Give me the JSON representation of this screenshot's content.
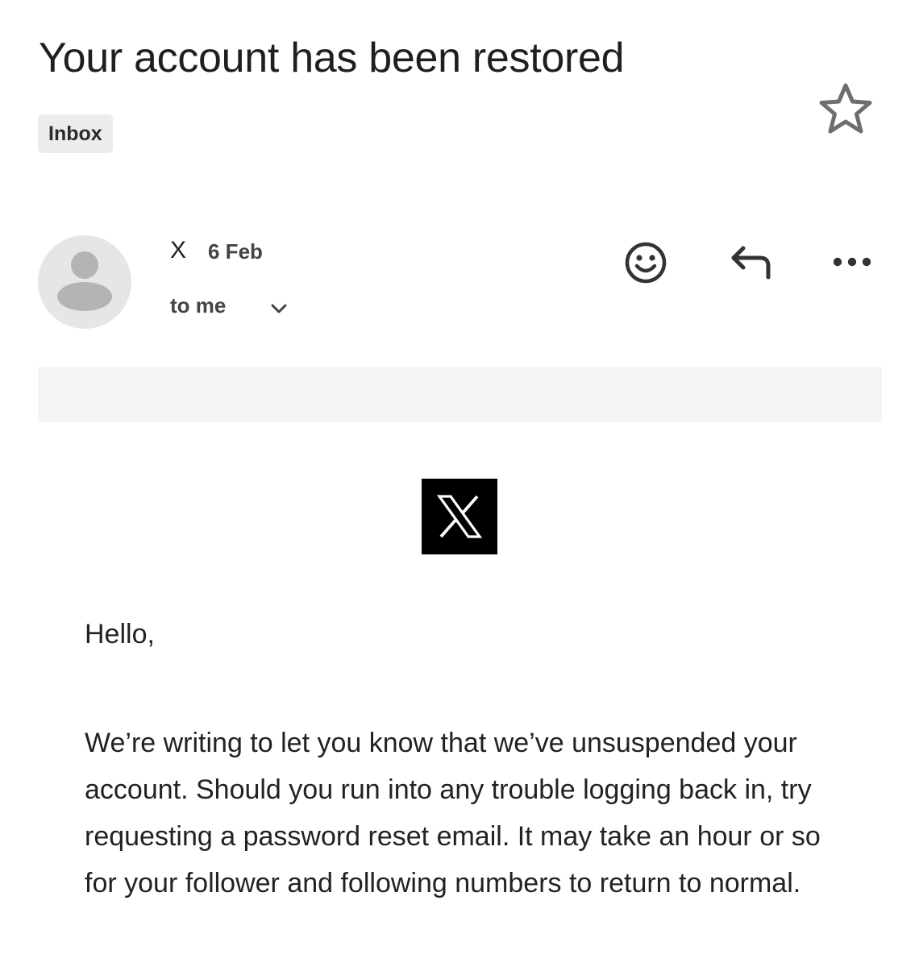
{
  "email": {
    "subject": "Your account has been restored",
    "label": "Inbox",
    "icons": {
      "star": "star-outline-icon",
      "avatar": "person-icon",
      "details": "chevron-down-icon",
      "emoji": "smiley-icon",
      "reply": "reply-icon",
      "more": "more-horizontal-icon",
      "logo": "x-logo"
    }
  },
  "sender": {
    "name": "X",
    "date": "6 Feb",
    "recipient": "to me"
  },
  "body": {
    "greeting": "Hello,",
    "paragraph": "We’re writing to let you know that we’ve unsuspended your account. Should you run into any trouble logging back in, try requesting a password reset email. It may take an hour or so for your follower and following numbers to return to normal."
  }
}
